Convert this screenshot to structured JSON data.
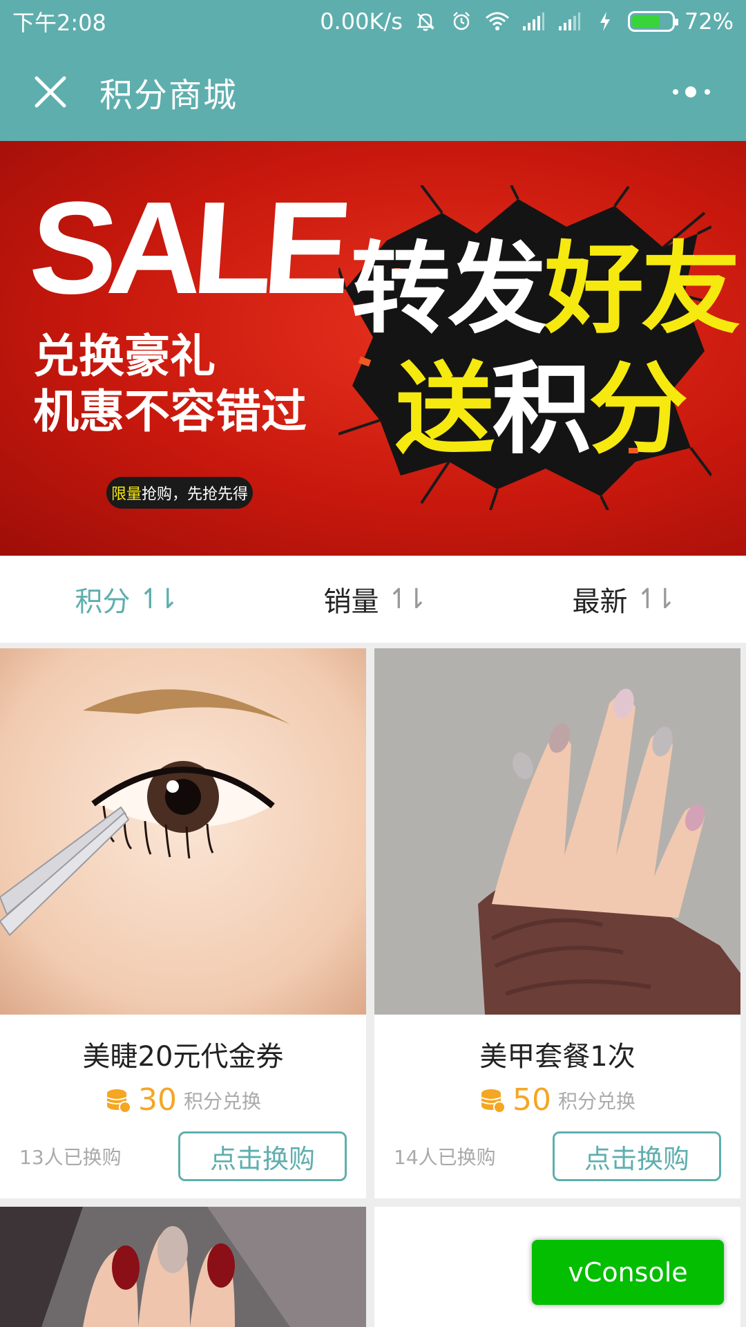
{
  "status_bar": {
    "time": "下午2:08",
    "network_speed": "0.00K/s",
    "battery_percent": "72%",
    "battery_level": 0.72,
    "icons": [
      "mute-bell-icon",
      "alarm-icon",
      "wifi-icon",
      "signal-icon",
      "signal-icon",
      "charging-icon",
      "battery-icon"
    ]
  },
  "header": {
    "title": "积分商城",
    "icons": {
      "close": "close-icon",
      "more": "more-dots-icon"
    }
  },
  "banner": {
    "sale": "SALE",
    "line1": "兑换豪礼",
    "line2": "机惠不容错过",
    "pill_highlight": "限量",
    "pill_rest": "抢购，先抢先得",
    "big_line1_a": "转",
    "big_line1_b": "发",
    "big_line1_c": "好",
    "big_line1_d": "友",
    "big_line2_a": "送",
    "big_line2_b": "积",
    "big_line2_c": "分",
    "colors": {
      "red": "#d11f12",
      "yellow": "#f6e90f"
    }
  },
  "sort_bar": {
    "items": [
      {
        "label": "积分",
        "arrows": "↿⇂",
        "active": true
      },
      {
        "label": "销量",
        "arrows": "↿⇂",
        "active": false
      },
      {
        "label": "最新",
        "arrows": "↿⇂",
        "active": false
      }
    ]
  },
  "products": [
    {
      "name": "美睫20元代金券",
      "points": "30",
      "points_label": "积分兑换",
      "sold": "13人已换购",
      "button": "点击换购",
      "image": "eyelash-photo"
    },
    {
      "name": "美甲套餐1次",
      "points": "50",
      "points_label": "积分兑换",
      "sold": "14人已换购",
      "button": "点击换购",
      "image": "nail-photo"
    }
  ],
  "vconsole": {
    "label": "vConsole"
  },
  "colors": {
    "theme": "#5faeae",
    "accent": "#f5a623",
    "vconsole": "#04be02"
  }
}
